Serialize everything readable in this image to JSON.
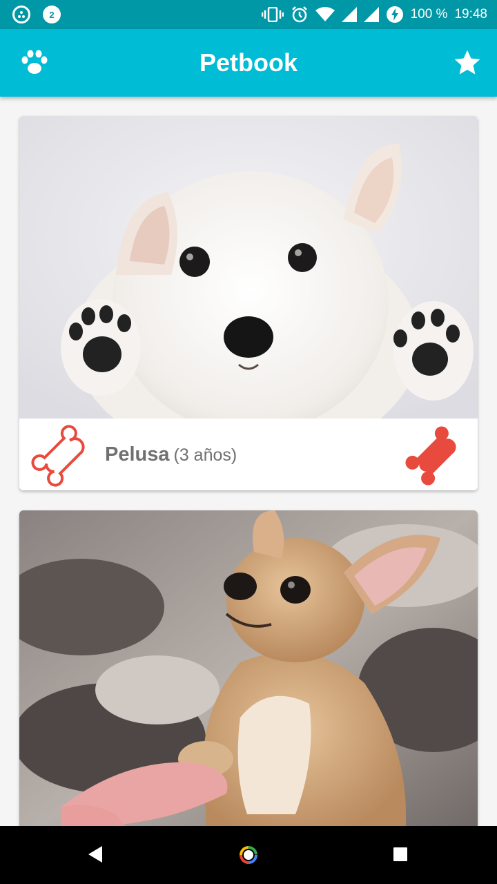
{
  "status_bar": {
    "notification_count": "2",
    "battery": "100 %",
    "time": "19:48",
    "icons": [
      "sync-icon",
      "notification-badge-icon",
      "vibrate-icon",
      "alarm-icon",
      "wifi-icon",
      "signal-icon",
      "signal-icon",
      "battery-charging-icon"
    ]
  },
  "app_bar": {
    "title": "Petbook",
    "left_icon": "paw-icon",
    "right_icon": "star-icon",
    "color": "#00bcd4",
    "status_color": "#0097a7"
  },
  "pets": [
    {
      "name": "Pelusa",
      "age": "(3 años)",
      "photo": "white puppy",
      "like_icon": "bone-outline-icon",
      "rate_icon": "bone-filled-icon"
    },
    {
      "photo": "chihuahua"
    }
  ],
  "accent_color": "#e84a3e",
  "nav_bar": {
    "icons": [
      "back-icon",
      "home-icon",
      "recents-icon"
    ]
  }
}
